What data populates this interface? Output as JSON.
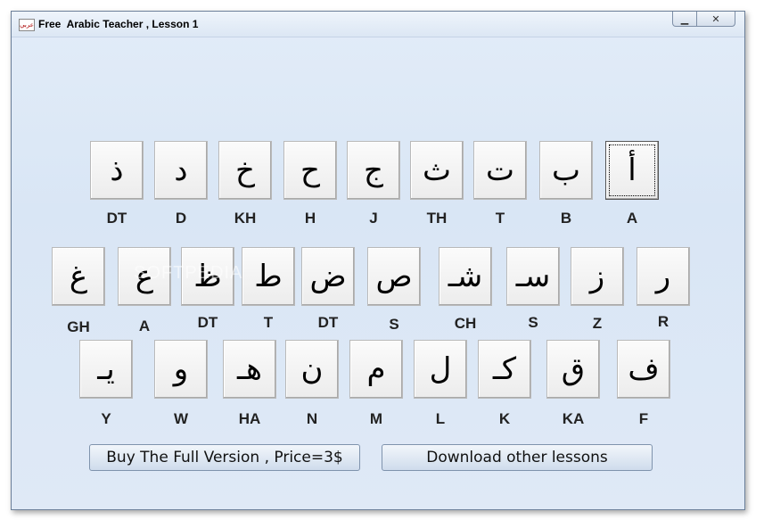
{
  "window": {
    "title": "Free  Arabic Teacher , Lesson 1"
  },
  "rows": [
    [
      {
        "letter": "ذ",
        "label": "DT"
      },
      {
        "letter": "د",
        "label": "D"
      },
      {
        "letter": "خ",
        "label": "KH"
      },
      {
        "letter": "ح",
        "label": "H"
      },
      {
        "letter": "ج",
        "label": "J"
      },
      {
        "letter": "ث",
        "label": "TH"
      },
      {
        "letter": "ت",
        "label": "T"
      },
      {
        "letter": "ب",
        "label": "B"
      },
      {
        "letter": "أ",
        "label": "A"
      }
    ],
    [
      {
        "letter": "غ",
        "label": "GH"
      },
      {
        "letter": "ع",
        "label": "A"
      },
      {
        "letter": "ظ",
        "label": "DT"
      },
      {
        "letter": "ط",
        "label": "T"
      },
      {
        "letter": "ض",
        "label": "DT"
      },
      {
        "letter": "ص",
        "label": "S"
      },
      {
        "letter": "شـ",
        "label": "CH"
      },
      {
        "letter": "سـ",
        "label": "S"
      },
      {
        "letter": "ز",
        "label": "Z"
      },
      {
        "letter": "ر",
        "label": "R"
      }
    ],
    [
      {
        "letter": "يـ",
        "label": "Y"
      },
      {
        "letter": "و",
        "label": "W"
      },
      {
        "letter": "هـ",
        "label": "HA"
      },
      {
        "letter": "ن",
        "label": "N"
      },
      {
        "letter": "م",
        "label": "M"
      },
      {
        "letter": "ل",
        "label": "L"
      },
      {
        "letter": "كـ",
        "label": "K"
      },
      {
        "letter": "ق",
        "label": "KA"
      },
      {
        "letter": "ف",
        "label": "F"
      }
    ]
  ],
  "buttons": {
    "buy": "Buy The Full Version , Price=3$",
    "download": "Download other lessons"
  },
  "watermark": "SOFTPEDIA"
}
